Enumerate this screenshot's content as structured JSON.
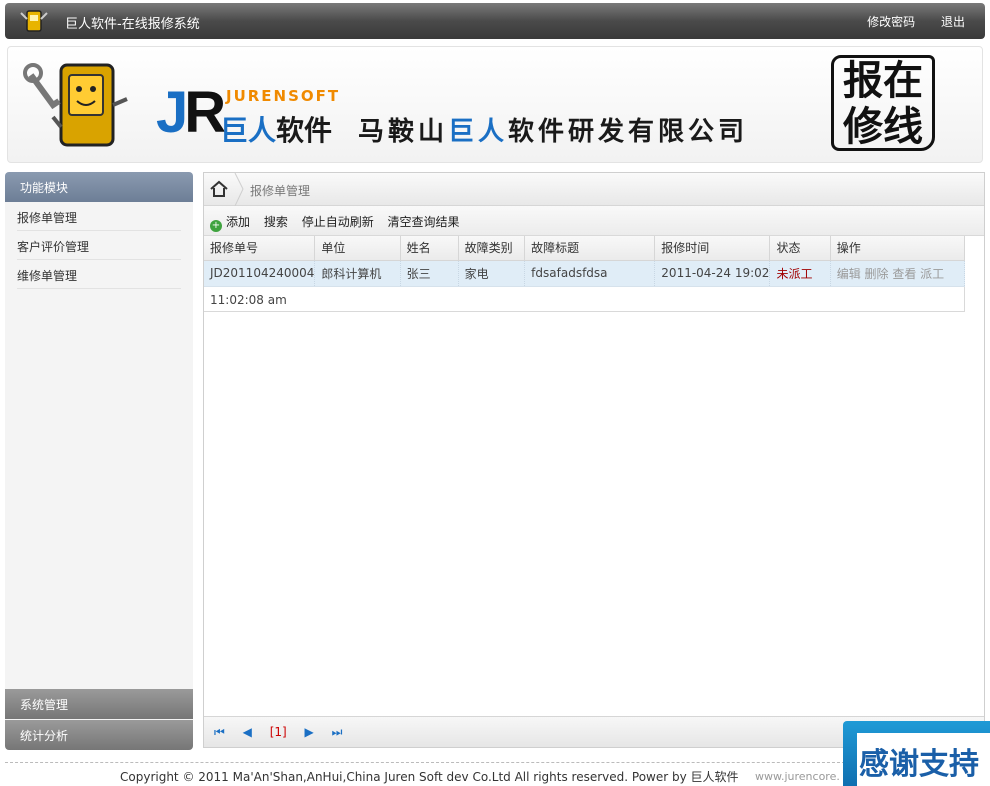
{
  "topbar": {
    "title": "巨人软件-在线报修系统",
    "change_password": "修改密码",
    "logout": "退出"
  },
  "banner": {
    "jr_j": "J",
    "jr_r": "R",
    "jurensoft": "JURENSOFT",
    "brand_a": "巨人",
    "brand_b": "软件",
    "company_a": "马鞍山",
    "company_b": "巨人",
    "company_c": "软件研发有限公司",
    "seal_1": "报在",
    "seal_2": "修线"
  },
  "sidebar": {
    "header": "功能模块",
    "items": [
      {
        "label": "报修单管理"
      },
      {
        "label": "客户评价管理"
      },
      {
        "label": "维修单管理"
      }
    ],
    "footer_1": "系统管理",
    "footer_2": "统计分析"
  },
  "breadcrumb": {
    "title": "报修单管理"
  },
  "toolbar": {
    "add": "添加",
    "search": "搜索",
    "stop_refresh": "停止自动刷新",
    "clear": "清空查询结果"
  },
  "table": {
    "headers": [
      "报修单号",
      "单位",
      "姓名",
      "故障类别",
      "故障标题",
      "报修时间",
      "状态",
      "操作"
    ],
    "rows": [
      {
        "id": "JD201104240004",
        "unit": "郎科计算机",
        "name": "张三",
        "category": "家电",
        "title": "fdsafadsfdsa",
        "time": "2011-04-24 19:02",
        "status": "未派工",
        "ops": "编辑 删除 查看 派工"
      }
    ],
    "timer": "11:02:08 am"
  },
  "pager": {
    "first": "⏮",
    "prev": "◀",
    "current": "[1]",
    "next": "▶",
    "last": "⏭"
  },
  "footer": {
    "copyright": "Copyright © 2011 Ma'An'Shan,AnHui,China Juren Soft dev Co.Ltd All rights reserved. Power by 巨人软件",
    "site": "www.jurencore.",
    "thanks": "感谢支持"
  },
  "colors": {
    "accent": "#1a6fc4",
    "status_red": "#a00000",
    "row_bg": "#e0edf7"
  }
}
